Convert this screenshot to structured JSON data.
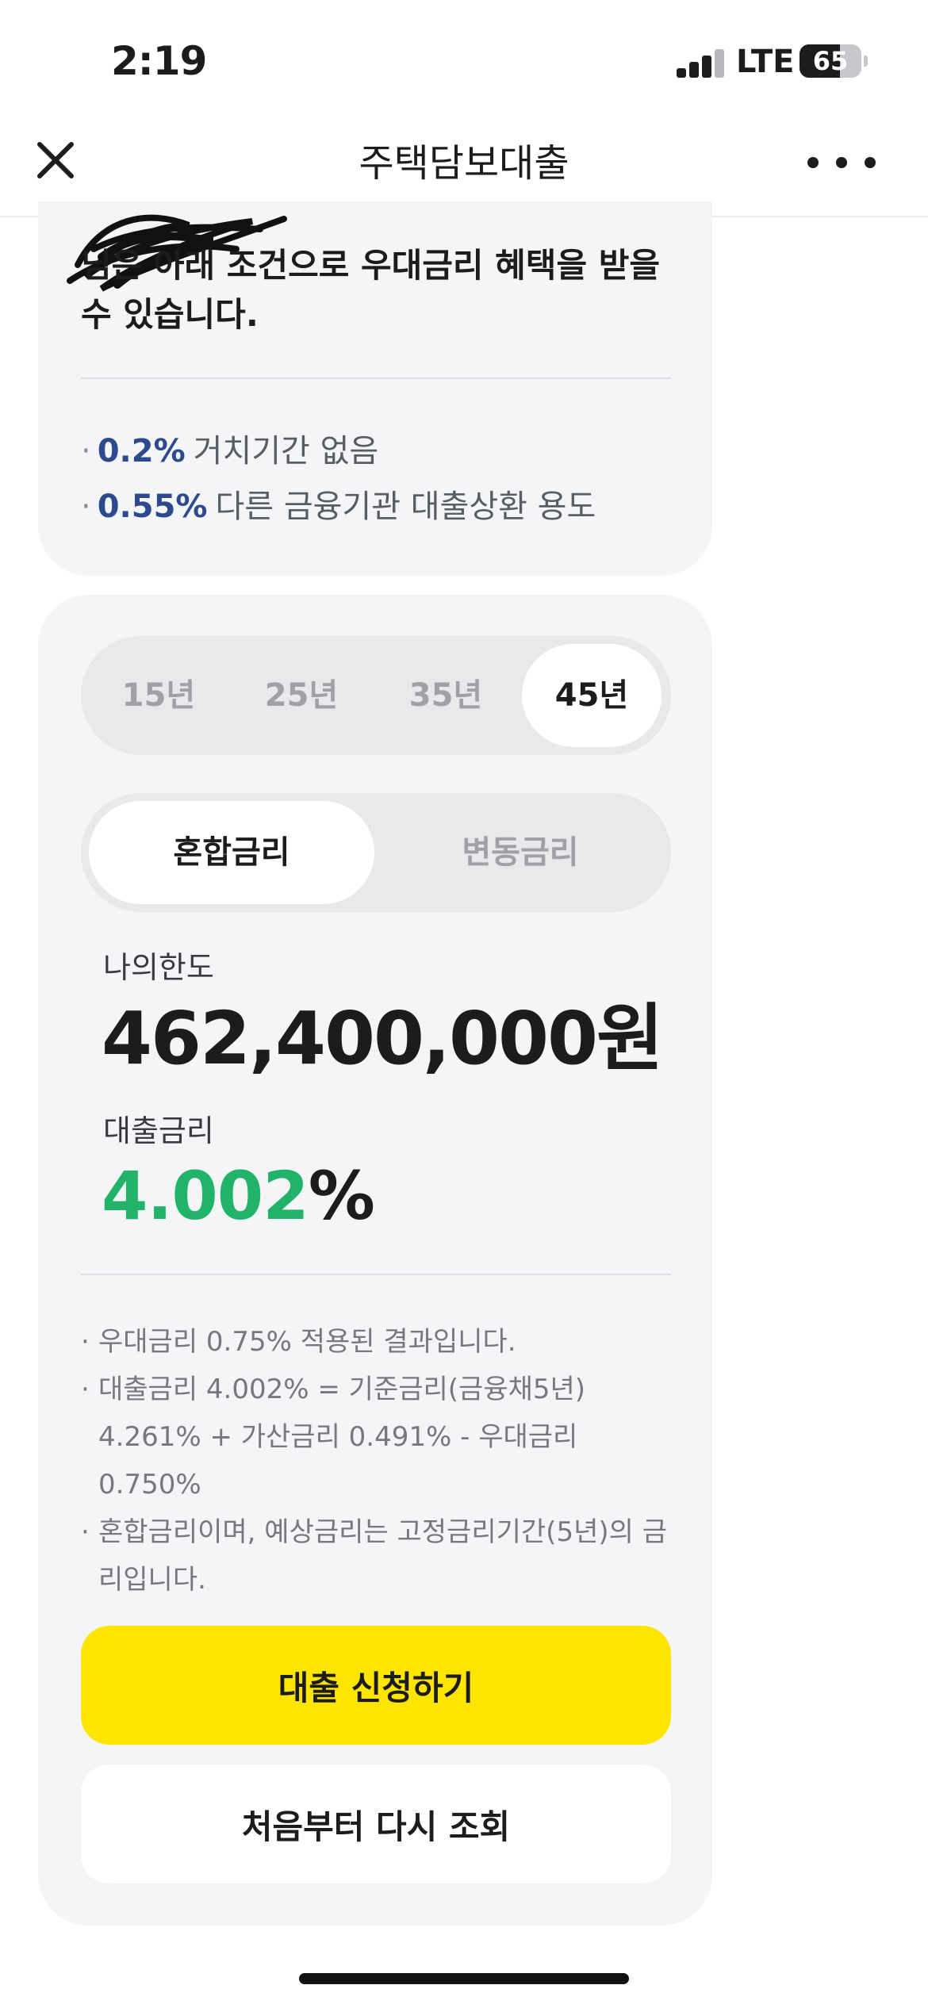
{
  "status_bar": {
    "time": "2:19",
    "network": "LTE",
    "battery_level": "65",
    "icons": [
      "signal-icon",
      "battery-icon"
    ]
  },
  "nav": {
    "title": "주택담보대출",
    "icons": [
      "close-icon",
      "more-icon"
    ]
  },
  "benefit": {
    "title": "님은 아래 조건으로 우대금리 혜택을 받을 수 있습니다.",
    "items": [
      {
        "rate": "0.2%",
        "text": "거치기간 없음"
      },
      {
        "rate": "0.55%",
        "text": "다른 금융기관 대출상환 용도"
      }
    ]
  },
  "loan": {
    "terms": [
      "15년",
      "25년",
      "35년",
      "45년"
    ],
    "selected_term": "45년",
    "rate_types": [
      "혼합금리",
      "변동금리"
    ],
    "selected_rate_type": "혼합금리",
    "limit_label": "나의한도",
    "limit_value": "462,400,000원",
    "rate_label": "대출금리",
    "rate_number": "4.002",
    "rate_unit": "%",
    "notes": [
      "우대금리 0.75% 적용된 결과입니다.",
      "대출금리 4.002% = 기준금리(금융채5년) 4.261% + 가산금리 0.491% - 우대금리 0.750%",
      "혼합금리이며, 예상금리는 고정금리기간(5년)의 금리입니다."
    ],
    "apply_button": "대출 신청하기",
    "restart_button": "처음부터 다시 조회"
  },
  "colors": {
    "accent_yellow": "#fee500",
    "rate_green": "#22b36a",
    "benefit_blue": "#2e4a8f",
    "card_bg": "#f4f5f7"
  }
}
